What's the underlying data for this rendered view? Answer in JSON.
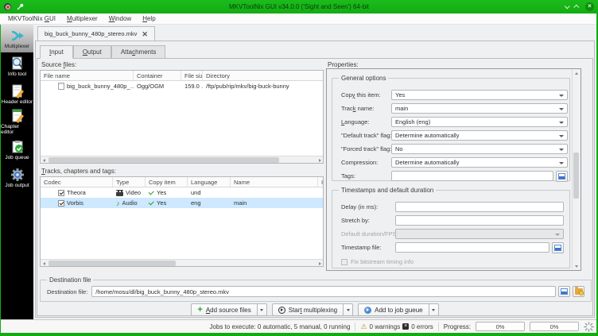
{
  "colors": {
    "titlebar_green": "#12ac12",
    "selection_blue": "#cde8ff",
    "check_green": "#2ca02c",
    "accent_blue": "#3d74c4",
    "sidebar_black": "#000000"
  },
  "titlebar": {
    "title": "MKVToolNix GUI v34.0.0 ('Sight and Seen') 64-bit"
  },
  "menubar": {
    "items": [
      {
        "label": "MKVToolNix GUI",
        "mnemonic": 11
      },
      {
        "label": "Multiplexer",
        "mnemonic": 0
      },
      {
        "label": "Window",
        "mnemonic": 0
      },
      {
        "label": "Help",
        "mnemonic": 0
      }
    ]
  },
  "sidebar": {
    "items": [
      {
        "label": "Multiplexer"
      },
      {
        "label": "Info tool"
      },
      {
        "label": "Header editor"
      },
      {
        "label": "Chapter editor"
      },
      {
        "label": "Job queue"
      },
      {
        "label": "Job output"
      }
    ]
  },
  "file_tab": {
    "label": "big_buck_bunny_480p_stereo.mkv"
  },
  "tabs": [
    {
      "label": "Input",
      "mnemonic": 0
    },
    {
      "label": "Output",
      "mnemonic": 0
    },
    {
      "label": "Attachments",
      "mnemonic": 4
    }
  ],
  "source_files": {
    "label": "Source files:",
    "columns": [
      "File name",
      "Container",
      "File size",
      "Directory"
    ],
    "rows": [
      {
        "file_name": "big_buck_bunny_480p_…",
        "container": "Ogg/OGM",
        "file_size": "159.0 …",
        "directory": "/ftp/pub/rip/mkv/big-buck-bunny"
      }
    ]
  },
  "tracks": {
    "label": "Tracks, chapters and tags:",
    "columns": [
      "Codec",
      "Type",
      "Copy item",
      "Language",
      "Name",
      "I"
    ],
    "rows": [
      {
        "codec": "Theora",
        "type": "Video",
        "copy_item": "Yes",
        "language": "und",
        "name": ""
      },
      {
        "codec": "Vorbis",
        "type": "Audio",
        "copy_item": "Yes",
        "language": "eng",
        "name": "main"
      }
    ]
  },
  "properties": {
    "label": "Properties:",
    "general": {
      "title": "General options",
      "copy_this_item": {
        "label": "Copy this item:",
        "value": "Yes"
      },
      "track_name": {
        "label": "Track name:",
        "value": "main"
      },
      "language": {
        "label": "Language:",
        "value": "English (eng)"
      },
      "default_track_flag": {
        "label": "\"Default track\" flag:",
        "value": "Determine automatically"
      },
      "forced_track_flag": {
        "label": "\"Forced track\" flag:",
        "value": "No"
      },
      "compression": {
        "label": "Compression:",
        "value": "Determine automatically"
      },
      "tags": {
        "label": "Tags:",
        "value": ""
      }
    },
    "timestamps": {
      "title": "Timestamps and default duration",
      "delay": {
        "label": "Delay (in ms):",
        "value": ""
      },
      "stretch_by": {
        "label": "Stretch by:",
        "value": ""
      },
      "default_duration": {
        "label": "Default duration/FPS:",
        "value": ""
      },
      "timestamp_file": {
        "label": "Timestamp file:",
        "value": ""
      },
      "fix_bitstream": {
        "label": "Fix bitstream timing info"
      }
    }
  },
  "destination": {
    "group_title": "Destination file",
    "label": "Destination file:",
    "value": "/home/mosu/dl/big_buck_bunny_480p_stereo.mkv"
  },
  "actions": {
    "add_source_files": {
      "label": "Add source files",
      "mnemonic": 0
    },
    "start_multiplexing": {
      "label": "Start multiplexing",
      "mnemonic": 4
    },
    "add_to_job_queue": {
      "label": "Add to job queue",
      "mnemonic": 11
    }
  },
  "statusbar": {
    "jobs": "Jobs to execute: 0 automatic, 5 manual, 0 running",
    "warnings": "0 warnings",
    "errors": "0 errors",
    "progress_label": "Progress:",
    "progress_left": "0%",
    "progress_right": "0%"
  }
}
